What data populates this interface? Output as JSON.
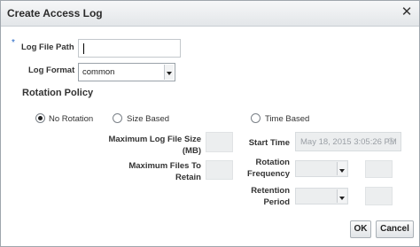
{
  "dialog": {
    "title": "Create Access Log",
    "close_glyph": "✕"
  },
  "form": {
    "required_marker": "*",
    "log_file_path_label": "Log File Path",
    "log_file_path_value": "",
    "log_format_label": "Log Format",
    "log_format_value": "common"
  },
  "rotation": {
    "section_title": "Rotation Policy",
    "options": [
      {
        "label": "No Rotation",
        "selected": true
      },
      {
        "label": "Size Based",
        "selected": false
      },
      {
        "label": "Time Based",
        "selected": false
      }
    ],
    "max_log_file_size_label": "Maximum Log File Size (MB)",
    "max_files_label": "Maximum Files To Retain",
    "start_time_label": "Start Time",
    "start_time_value": "May 18, 2015 3:05:26 PM",
    "rotation_frequency_label": "Rotation Frequency",
    "retention_period_label": "Retention Period"
  },
  "buttons": {
    "ok": "OK",
    "cancel": "Cancel"
  }
}
